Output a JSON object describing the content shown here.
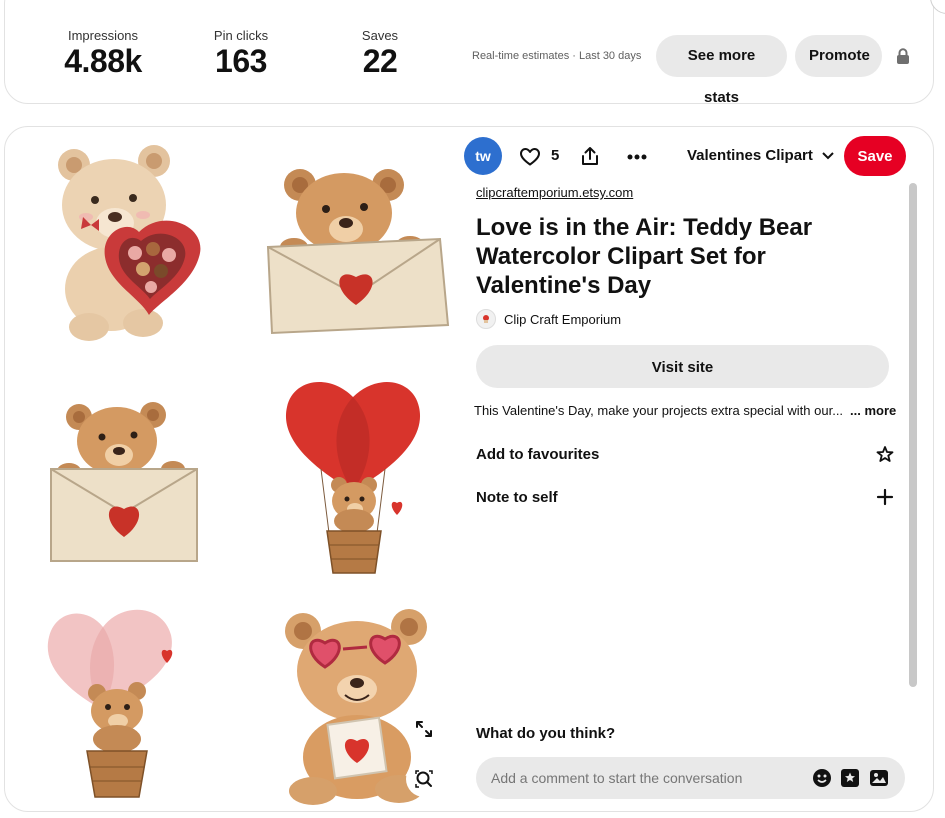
{
  "stats": [
    {
      "label": "Impressions",
      "value": "4.88k"
    },
    {
      "label": "Pin clicks",
      "value": "163"
    },
    {
      "label": "Saves",
      "value": "22"
    }
  ],
  "stats_note": "Real-time estimates · Last 30 days",
  "buttons": {
    "see_more_stats": "See more stats",
    "promote": "Promote"
  },
  "toolbar": {
    "avatar_text": "tw",
    "like_count": "5",
    "board_name": "Valentines Clipart",
    "save_label": "Save"
  },
  "pin": {
    "source_link": "clipcraftemporium.etsy.com",
    "title": "Love is in the Air: Teddy Bear Watercolor Clipart Set for Valentine's Day",
    "creator_name": "Clip Craft Emporium",
    "visit_label": "Visit site",
    "description": "This Valentine's Day, make your projects extra special with our...",
    "more_label": "... more",
    "favourites_label": "Add to favourites",
    "note_label": "Note to self"
  },
  "comments": {
    "heading": "What do you think?",
    "placeholder": "Add a comment to start the conversation"
  },
  "colors": {
    "save_red": "#e60023",
    "avatar_blue": "#2d6fcf",
    "pill_gray": "#e9e9e9",
    "bear_brown": "#c48a55",
    "heart_red": "#d8342c"
  },
  "icons": [
    "lock-icon",
    "heart-icon",
    "share-icon",
    "more-icon",
    "chevron-down-icon",
    "star-icon",
    "plus-icon",
    "expand-icon",
    "visual-search-icon",
    "emoji-icon",
    "sticker-icon",
    "image-icon"
  ]
}
